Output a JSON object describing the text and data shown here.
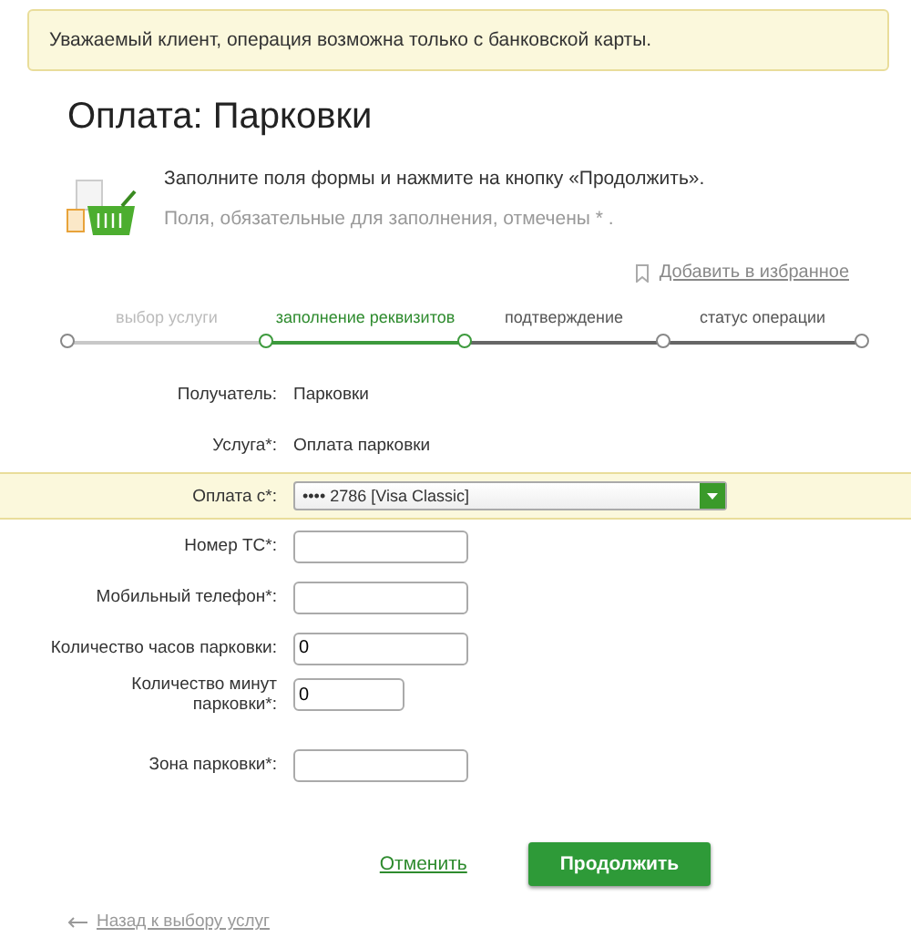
{
  "notice": "Уважаемый клиент, операция возможна только с банковской карты.",
  "title": "Оплата: Парковки",
  "intro": {
    "instruction": "Заполните поля формы и нажмите на кнопку «Продолжить».",
    "required_note": "Поля, обязательные для заполнения, отмечены * ."
  },
  "favorite_link": "Добавить в избранное",
  "steps": [
    {
      "label": "выбор услуги",
      "completed": true,
      "selected": false
    },
    {
      "label": "заполнение реквизитов",
      "completed": false,
      "selected": true
    },
    {
      "label": "подтверждение",
      "completed": false,
      "selected": false
    },
    {
      "label": "статус операции",
      "completed": false,
      "selected": false
    }
  ],
  "fields": [
    {
      "kind": "static",
      "label": "Получатель:",
      "value": "Парковки",
      "highlighted": false
    },
    {
      "kind": "static",
      "label": "Услуга*:",
      "value": "Оплата парковки",
      "highlighted": false
    },
    {
      "kind": "select",
      "label": "Оплата с*:",
      "value": "•••• 2786 [Visa Classic]",
      "highlighted": true
    },
    {
      "kind": "input",
      "label": "Номер ТС*:",
      "short": false,
      "highlighted": false
    },
    {
      "kind": "input",
      "label": "Мобильный телефон*:",
      "short": false,
      "highlighted": false
    },
    {
      "kind": "input",
      "label": "Количество часов парковки:",
      "value": "0",
      "short": false,
      "highlighted": false
    },
    {
      "kind": "input",
      "label": "Количество минут парковки*:",
      "value": "0",
      "short": true,
      "highlighted": false
    },
    {
      "kind": "input",
      "label": "Зона парковки*:",
      "short": false,
      "highlighted": false
    }
  ],
  "buttons": {
    "cancel": "Отменить",
    "continue": "Продолжить"
  },
  "back_link": "Назад к выбору услуг"
}
